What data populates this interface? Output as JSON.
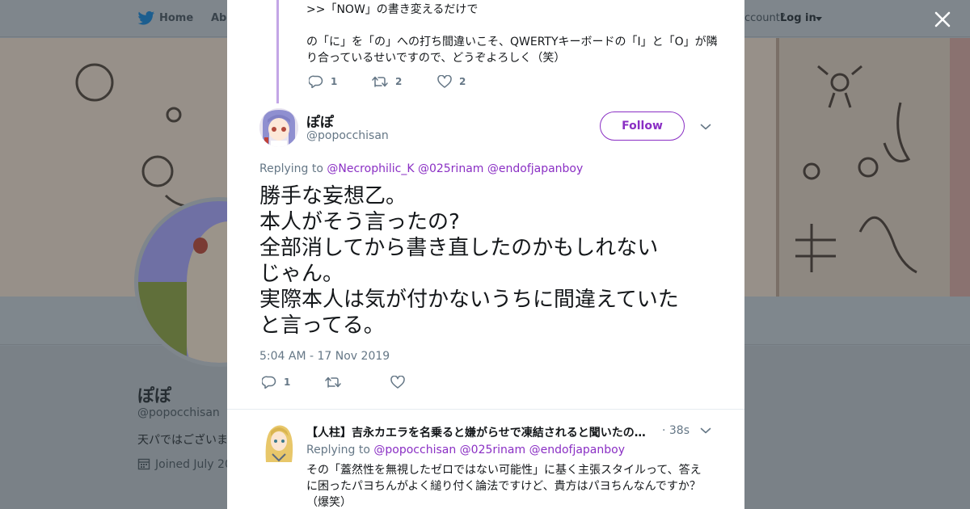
{
  "nav": {
    "home": "Home",
    "about": "Abo",
    "account_prompt": "ccount?",
    "login": "Log in"
  },
  "profile": {
    "name": "ぽぽ",
    "handle": "@popocchisan",
    "bio": "天パではございま",
    "joined": "Joined July 20"
  },
  "previous_tweet": {
    "line1": ">>「NOW」の書き変えるだけで",
    "line2": "の「に」を「の」への打ち間違いこそ、QWERTYキーボードの「I」と「O」が隣り合っているせいですので、どうぞよろしく（笑）",
    "reply_count": "1",
    "retweet_count": "2",
    "like_count": "2"
  },
  "main_tweet": {
    "name": "ぽぽ",
    "handle": "@popocchisan",
    "follow_label": "Follow",
    "replying_prefix": "Replying to",
    "mentions": [
      "@Necrophilic_K",
      "@025rinam",
      "@endofjapanboy"
    ],
    "text_lines": [
      "勝手な妄想乙。",
      "本人がそう言ったの?",
      "全部消してから書き直したのかもしれない",
      "じゃん。",
      "実際本人は気が付かないうちに間違えていた",
      "と言ってる。"
    ],
    "timestamp": "5:04 AM - 17 Nov 2019",
    "reply_count": "1"
  },
  "reply_tweet": {
    "name": "【人柱】吉永カエラを名乗ると嫌がらせで凍結されると聞いたので試してみた",
    "time": "· 38s",
    "replying_prefix": "Replying to",
    "mentions": [
      "@popocchisan",
      "@025rinam",
      "@endofjapanboy"
    ],
    "text": "その「蓋然性を無視したゼロではない可能性」に基く主張スタイルって、答えに困ったパヨちんがよく縋り付く論法ですけど、貴方はパヨちんなんですか？（爆笑）"
  },
  "colors": {
    "accent": "#8a2fc4",
    "thread_line": "#c3a6e6",
    "muted_text": "#657786",
    "overlay": "#7d858c"
  },
  "icons": {
    "nav_logo": "bird-icon",
    "close": "close-icon",
    "reply": "reply-icon",
    "retweet": "retweet-icon",
    "like": "heart-icon",
    "more": "chevron-down-icon",
    "calendar": "calendar-icon"
  }
}
